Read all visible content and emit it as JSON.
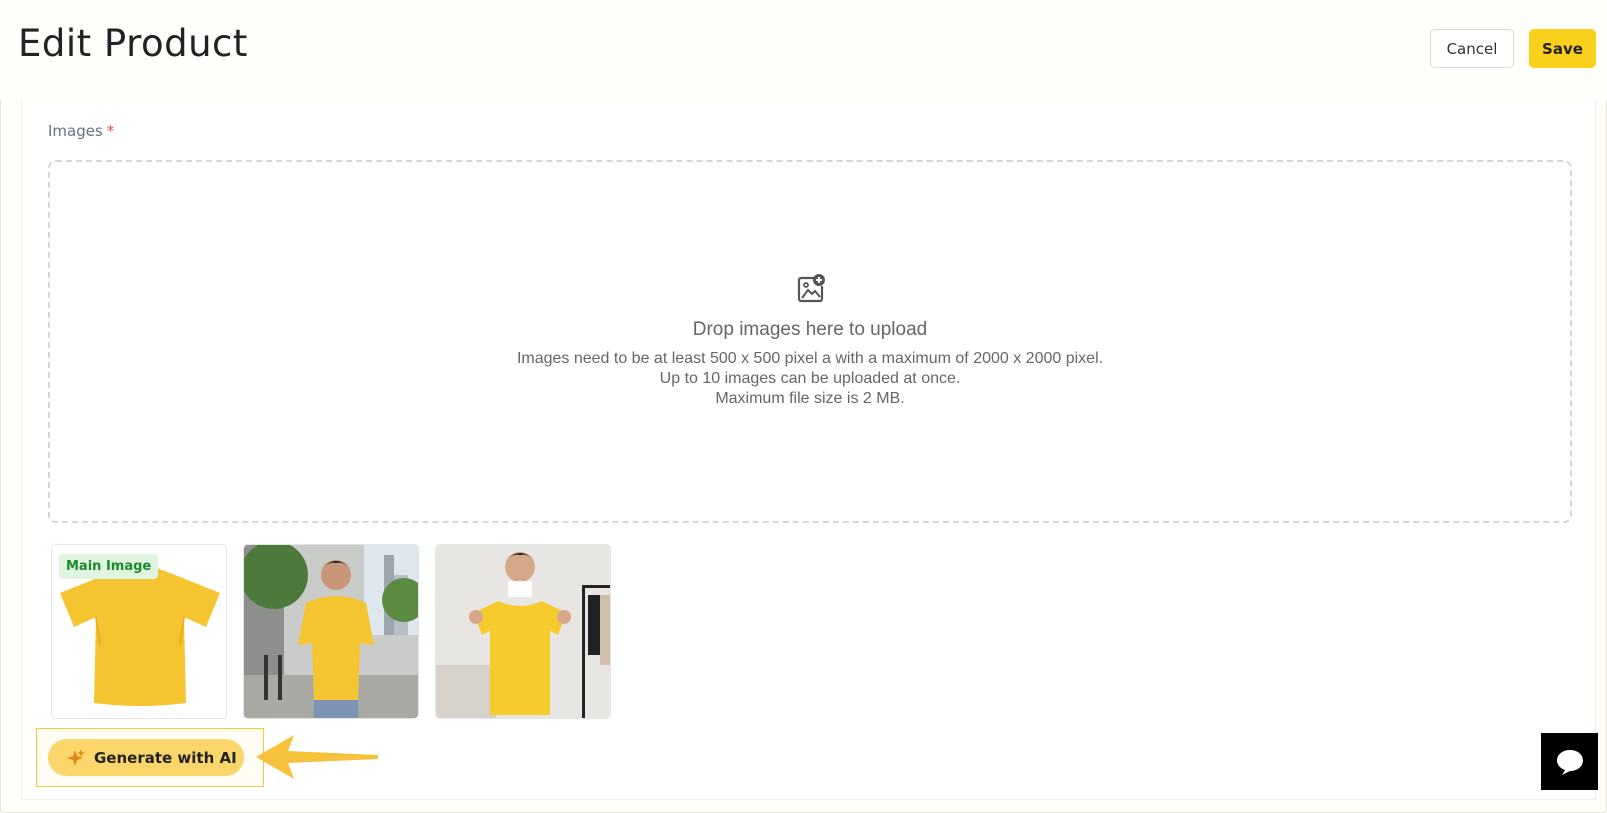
{
  "header": {
    "title": "Edit Product",
    "cancel_label": "Cancel",
    "save_label": "Save"
  },
  "images_field": {
    "label": "Images",
    "required_marker": "*",
    "dropzone": {
      "icon": "image-add-icon",
      "title": "Drop images here to upload",
      "line1": "Images need to be at least 500 x 500 pixel a with a maximum of 2000 x 2000 pixel.",
      "line2": "Up to 10 images can be uploaded at once.",
      "line3": "Maximum file size is 2 MB."
    },
    "thumbnails": [
      {
        "badge": "Main Image",
        "subject": "yellow t-shirt product photo"
      },
      {
        "subject": "man wearing yellow t-shirt on city street"
      },
      {
        "subject": "man holding up yellow t-shirt indoors"
      }
    ]
  },
  "ai_button": {
    "label": "Generate with AI",
    "icon": "sparkle-icon"
  },
  "annotation": {
    "icon": "pointer-arrow-icon",
    "color": "#f6c23b"
  },
  "chat": {
    "icon": "chat-bubble-icon"
  },
  "colors": {
    "accent": "#f9d11c",
    "ai_button": "#fbd66a",
    "badge_bg": "#dff5df",
    "badge_text": "#1e8a2e",
    "required": "#e5484d"
  }
}
